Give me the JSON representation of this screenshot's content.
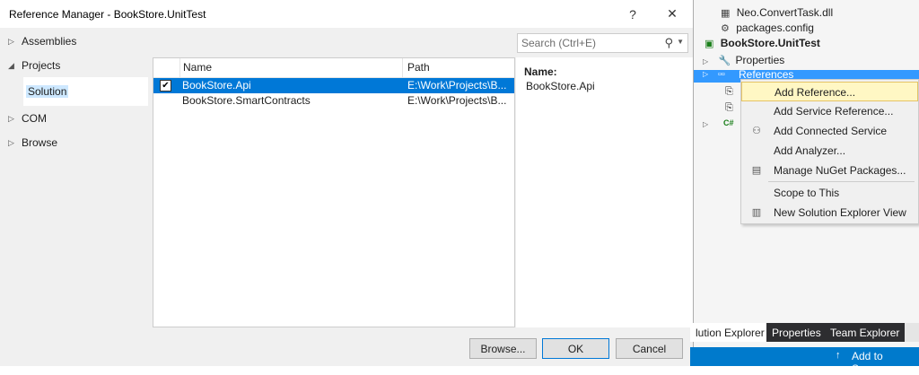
{
  "dialog": {
    "title": "Reference Manager - BookStore.UnitTest",
    "help_button": "?",
    "close_button": "✕",
    "nav": {
      "assemblies": "Assemblies",
      "projects": "Projects",
      "solution": "Solution",
      "com": "COM",
      "browse": "Browse"
    },
    "search": {
      "placeholder": "Search (Ctrl+E)"
    },
    "grid": {
      "columns": {
        "name": "Name",
        "path": "Path"
      },
      "rows": [
        {
          "name": "BookStore.Api",
          "path": "E:\\Work\\Projects\\B...",
          "checked": true,
          "selected": true
        },
        {
          "name": "BookStore.SmartContracts",
          "path": "E:\\Work\\Projects\\B...",
          "checked": false,
          "selected": false
        }
      ]
    },
    "details": {
      "label": "Name:",
      "value": "BookStore.Api"
    },
    "buttons": {
      "browse": "Browse...",
      "ok": "OK",
      "cancel": "Cancel"
    }
  },
  "solution_explorer": {
    "items": {
      "neo_task": "Neo.ConvertTask.dll",
      "packages": "packages.config",
      "project": "BookStore.UnitTest",
      "properties": "Properties",
      "references": "References"
    },
    "context_menu": {
      "add_reference": "Add Reference...",
      "add_service_reference": "Add Service Reference...",
      "add_connected_service": "Add Connected Service",
      "add_analyzer": "Add Analyzer...",
      "manage_nuget": "Manage NuGet Packages...",
      "scope_to_this": "Scope to This",
      "new_view": "New Solution Explorer View"
    },
    "tabs": {
      "solution_explorer": "lution Explorer",
      "properties": "Properties",
      "team_explorer": "Team Explorer"
    },
    "status": {
      "add_to_source": "Add to Source"
    }
  }
}
